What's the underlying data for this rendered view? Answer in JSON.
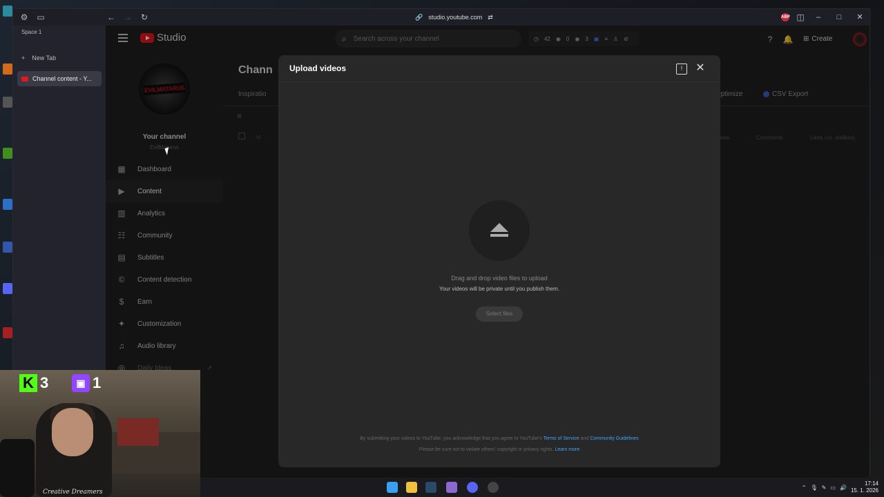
{
  "browser": {
    "space_label": "Space 1",
    "new_tab_label": "New Tab",
    "active_tab_label": "Channel content - Y...",
    "url": "studio.youtube.com",
    "extension_badge": "ABP"
  },
  "studio": {
    "logo_text": "Studio",
    "search_placeholder": "Search across your channel",
    "stats": {
      "a": "42",
      "b": "0",
      "c": "3"
    },
    "create_label": "Create",
    "channel": {
      "title": "Your channel",
      "handle": "EvilMatarus",
      "logo_text": "EVILMATARUS"
    },
    "nav": [
      {
        "label": "Dashboard",
        "icon": "dashboard-icon"
      },
      {
        "label": "Content",
        "icon": "content-icon"
      },
      {
        "label": "Analytics",
        "icon": "analytics-icon"
      },
      {
        "label": "Community",
        "icon": "community-icon"
      },
      {
        "label": "Subtitles",
        "icon": "subtitles-icon"
      },
      {
        "label": "Content detection",
        "icon": "copyright-icon"
      },
      {
        "label": "Earn",
        "icon": "dollar-icon"
      },
      {
        "label": "Customization",
        "icon": "wand-icon"
      },
      {
        "label": "Audio library",
        "icon": "audio-library-icon"
      },
      {
        "label": "Daily Ideas",
        "icon": "ideas-icon"
      }
    ],
    "main": {
      "header": "Chann",
      "tab_partial": "Inspiratio",
      "optimize_label": "Optimize",
      "csv_label": "CSV Export",
      "columns": {
        "views": "Views",
        "comments": "Comments",
        "likes": "Likes (vs. dislikes)",
        "video_partial": "Vi"
      }
    }
  },
  "upload_modal": {
    "title": "Upload videos",
    "drag_text": "Drag and drop video files to upload",
    "private_text": "Your videos will be private until you publish them.",
    "select_button": "Select files",
    "legal_line1": "By submitting your videos to YouTube, you acknowledge that you agree to YouTube's",
    "terms_link": "Terms of Service",
    "and_text": "and",
    "guidelines_link": "Community Guidelines",
    "legal_line2": "Please be sure not to violate others' copyright or privacy rights.",
    "learn_more": "Learn more"
  },
  "stream_overlay": {
    "kick_count": "3",
    "twitch_count": "1",
    "shirt_text": "Creative Dreamers"
  },
  "taskbar": {
    "time": "17:14",
    "date": "15. 1. 2026"
  }
}
